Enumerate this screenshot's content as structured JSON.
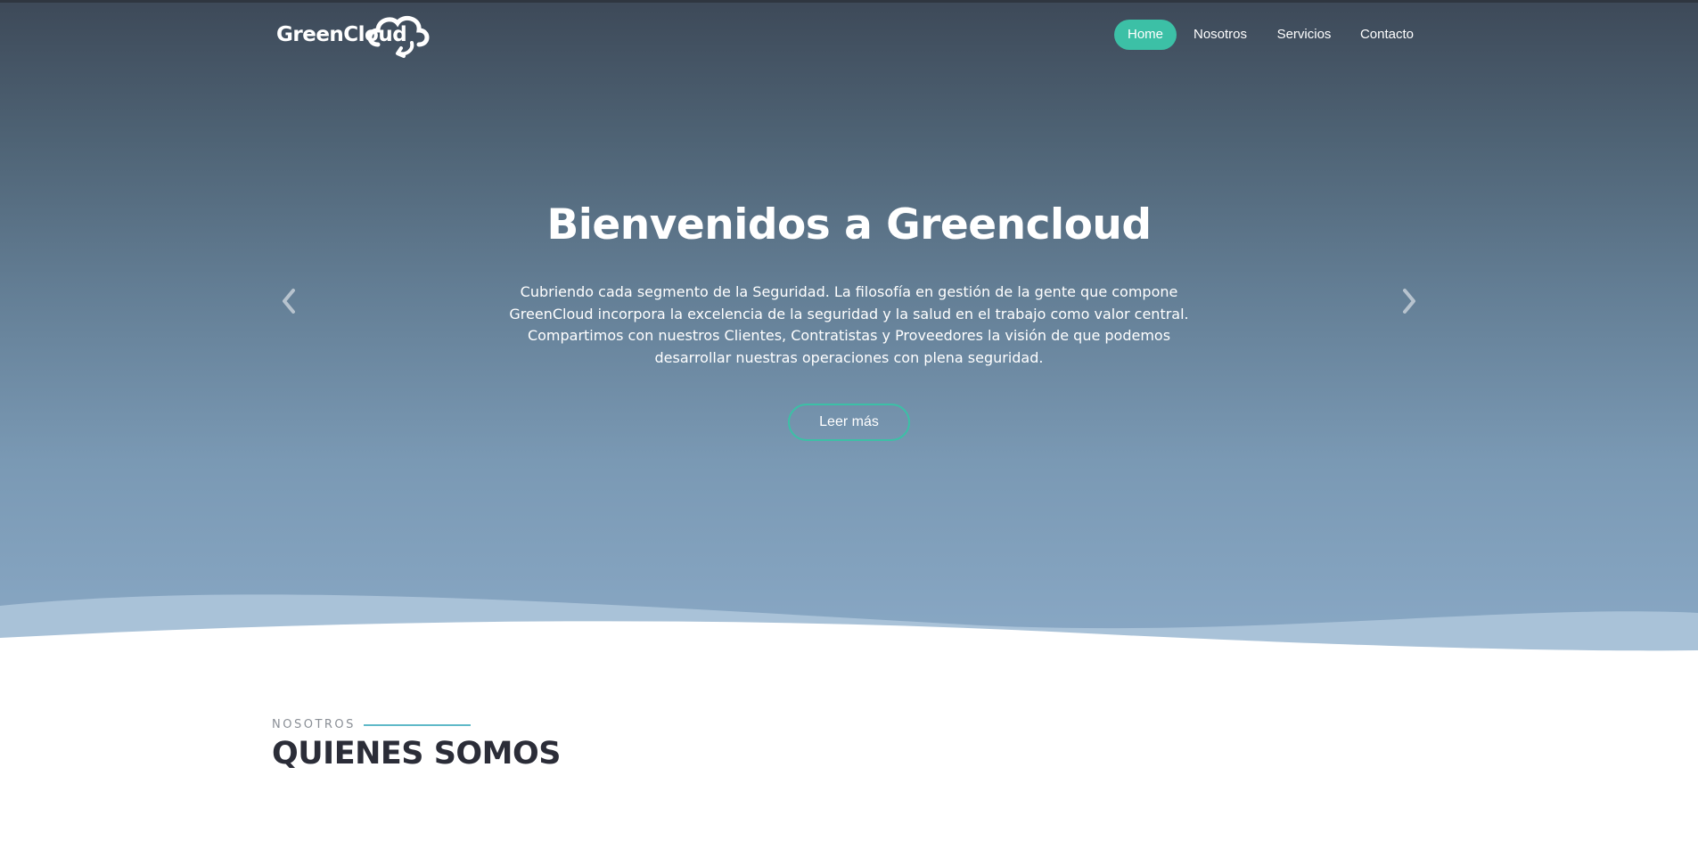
{
  "brand": {
    "name": "GreenCloud"
  },
  "nav": {
    "items": [
      {
        "label": "Home",
        "active": true
      },
      {
        "label": "Nosotros",
        "active": false
      },
      {
        "label": "Servicios",
        "active": false
      },
      {
        "label": "Contacto",
        "active": false
      }
    ]
  },
  "hero": {
    "title": "Bienvenidos a Greencloud",
    "description": "Cubriendo cada segmento de la Seguridad. La filosofía en gestión de la gente que compone GreenCloud incorpora la excelencia de la seguridad y la salud en el trabajo como valor central. Compartimos con nuestros Clientes, Contratistas y Proveedores la visión de que podemos desarrollar nuestras operaciones con plena seguridad.",
    "button_label": "Leer más",
    "prev_icon": "chevron-left-icon",
    "next_icon": "chevron-right-icon"
  },
  "section": {
    "eyebrow": "NOSOTROS",
    "title": "QUIENES SOMOS"
  },
  "colors": {
    "accent": "#3cc0a6",
    "eyebrow_line": "#5fb9c8",
    "heading": "#2b2d38"
  }
}
